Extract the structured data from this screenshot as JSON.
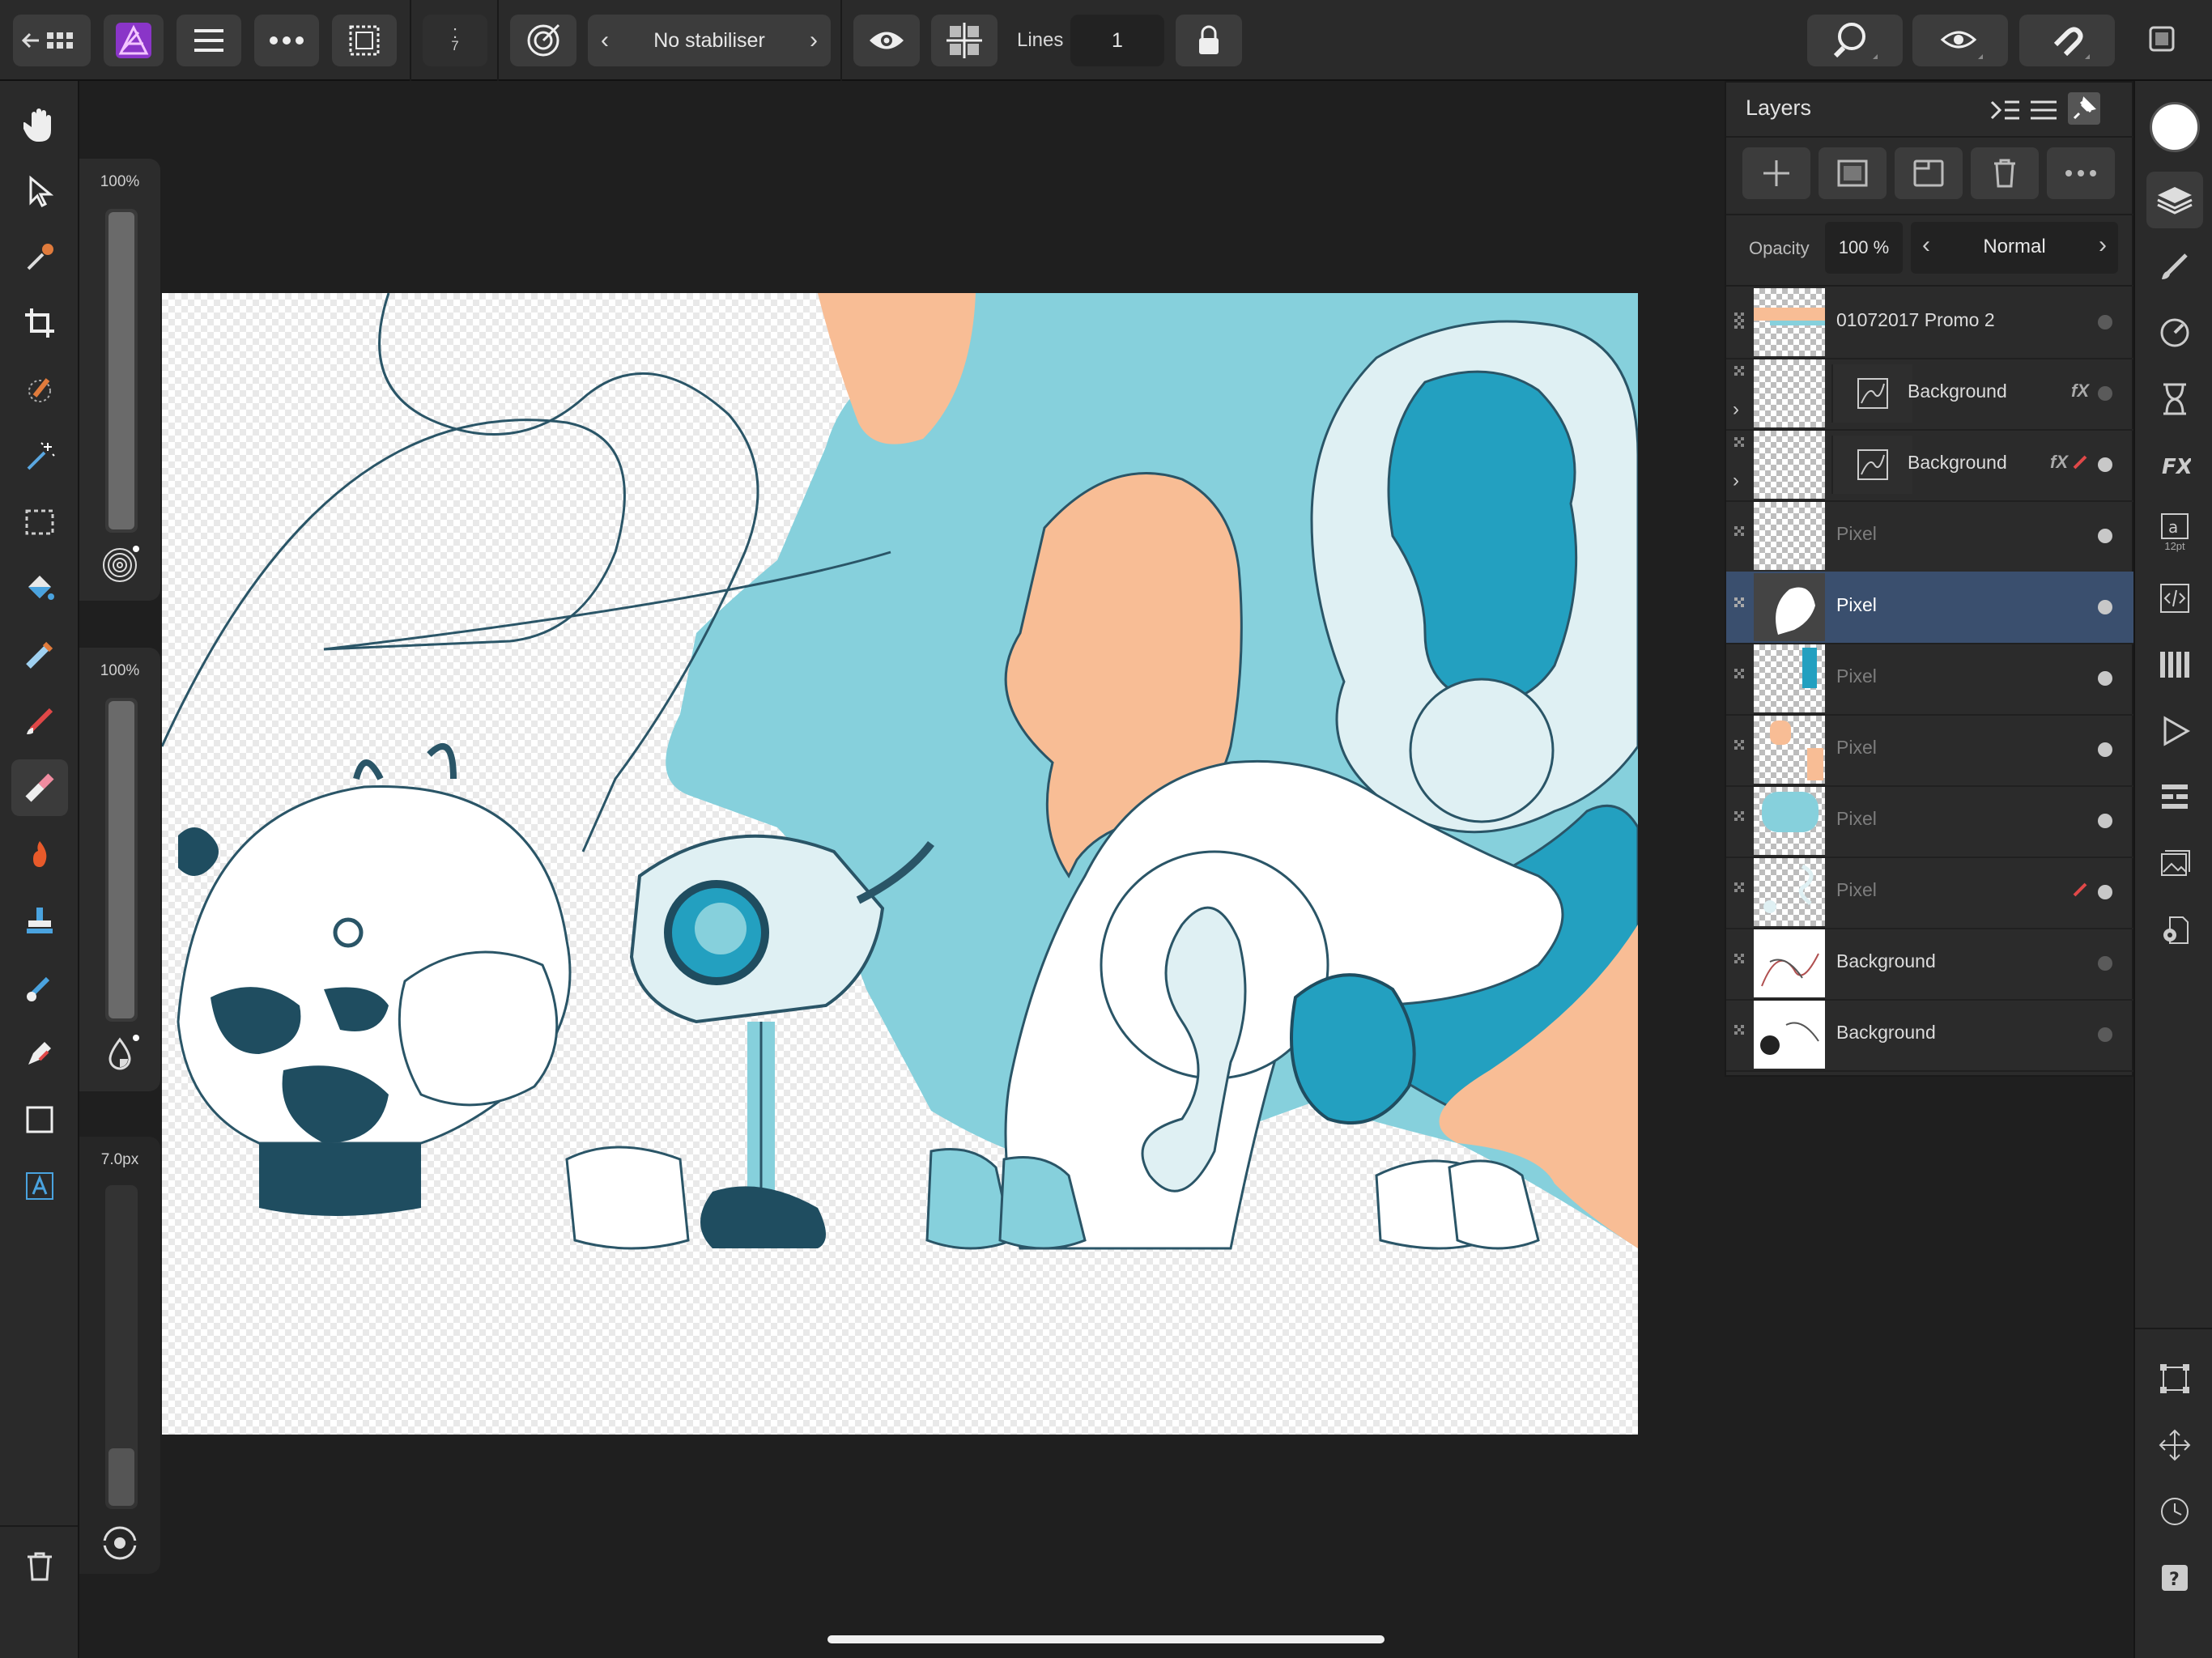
{
  "topbar": {
    "tab_count": "7",
    "stabiliser": "No stabiliser",
    "lines_label": "Lines",
    "lines_value": "1"
  },
  "sliders": {
    "size_label": "100%",
    "size_level": 1.0,
    "opacity_label": "100%",
    "opacity_level": 1.0,
    "width_label": "7.0px",
    "width_level": 0.18
  },
  "layers": {
    "title": "Layers",
    "opacity_label": "Opacity",
    "opacity_value": "100 %",
    "blend_mode": "Normal",
    "items": [
      {
        "name": "01072017 Promo 2",
        "dim": false,
        "visible": false
      },
      {
        "name": "Background",
        "dim": false,
        "visible": false,
        "fx": "fX"
      },
      {
        "name": "Background",
        "dim": false,
        "visible": true,
        "fx": "fX"
      },
      {
        "name": "Pixel",
        "dim": true,
        "visible": true
      },
      {
        "name": "Pixel",
        "dim": false,
        "visible": true,
        "selected": true
      },
      {
        "name": "Pixel",
        "dim": true,
        "visible": true
      },
      {
        "name": "Pixel",
        "dim": true,
        "visible": true
      },
      {
        "name": "Pixel",
        "dim": true,
        "visible": true
      },
      {
        "name": "Pixel",
        "dim": true,
        "visible": true
      },
      {
        "name": "Background",
        "dim": false,
        "visible": false
      },
      {
        "name": "Background",
        "dim": false,
        "visible": false
      }
    ]
  },
  "studio": {
    "text_size": "12pt"
  },
  "colors": {
    "canvas_teal": "#86d0dc",
    "canvas_peach": "#f8bd95",
    "canvas_dark": "#1f4d60",
    "selected_row": "#3a4f6e",
    "app_icon": "#8a35c8"
  }
}
